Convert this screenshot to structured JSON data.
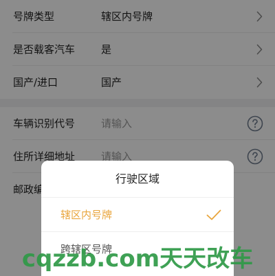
{
  "form": {
    "rows": [
      {
        "label": "号牌类型",
        "value": "辖区内号牌",
        "trailing": "chevron-right-icon"
      },
      {
        "label": "是否载客汽车",
        "value": "是",
        "trailing": "chevron-right-icon"
      },
      {
        "label": "国产/进口",
        "value": "国产",
        "trailing": "chevron-right-icon"
      },
      {
        "label": "车辆识别代号",
        "placeholder": "请输入",
        "trailing": "question-circle-icon"
      },
      {
        "label": "住所详细地址",
        "placeholder": "请输入",
        "trailing": "question-circle-icon"
      },
      {
        "label": "邮政编"
      }
    ]
  },
  "picker": {
    "title": "行驶区域",
    "options": [
      {
        "label": "辖区内号牌",
        "selected": true
      },
      {
        "label": "跨辖区号牌",
        "selected": false
      }
    ]
  },
  "watermark": {
    "text": "cqzzb.com天天改车"
  },
  "colors": {
    "accent": "#e9a53c",
    "watermark": "#2f9a47",
    "icon": "#8a8a8a"
  }
}
